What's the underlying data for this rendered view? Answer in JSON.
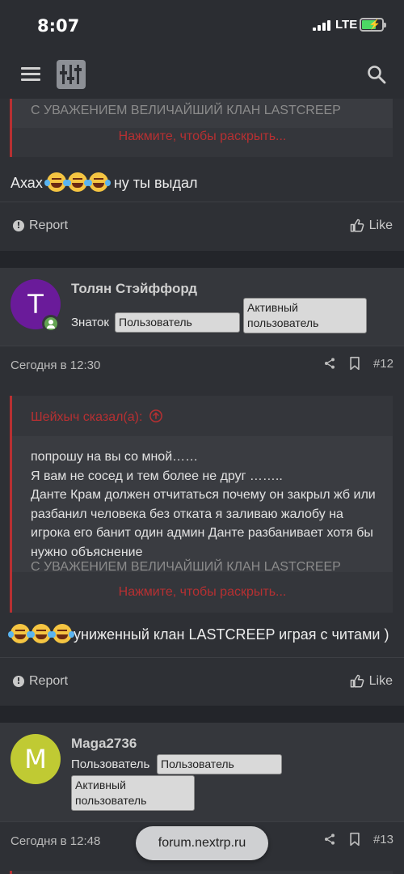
{
  "status_bar": {
    "time": "8:07",
    "network": "LTE"
  },
  "header": {
    "menu_icon": "hamburger-icon",
    "logo_icon": "forum-logo-icon",
    "search_icon": "search-icon"
  },
  "posts": [
    {
      "quote_fade_line": "С УВАЖЕНИЕМ ВЕЛИЧАЙШИЙ КЛАН LASTCREEP",
      "expand_label": "Нажмите, чтобы раскрыть...",
      "message_prefix": "Ахах",
      "message_suffix": "ну ты выдал",
      "report_label": "Report",
      "like_label": "Like"
    },
    {
      "username": "Толян Стэйффорд",
      "avatar_letter": "T",
      "avatar_color": "#6a1b9a",
      "rank": "Знаток",
      "badges": [
        "Пользователь",
        "Активный пользователь"
      ],
      "date": "Сегодня в 12:30",
      "post_number": "#12",
      "quote_author": "Шейхыч сказал(а):",
      "quote_lines": [
        "попрошу на вы со мной……",
        "Я вам не сосед и тем более не друг ……..",
        "Данте Крам должен отчитаться почему он закрыл жб или разбанил человека без отката я заливаю жалобу на игрока его банит один админ Данте разбанивает хотя бы нужно объяснение"
      ],
      "quote_fade_line": "С УВАЖЕНИЕМ ВЕЛИЧАЙШИЙ КЛАН LASTCREEP",
      "expand_label": "Нажмите, чтобы раскрыть...",
      "message_suffix": "униженный клан LASTCREEP играя с читами )",
      "report_label": "Report",
      "like_label": "Like"
    },
    {
      "username": "Maga2736",
      "avatar_letter": "M",
      "avatar_color": "#c0ca33",
      "rank": "Пользователь",
      "badges": [
        "Пользователь",
        "Активный пользователь"
      ],
      "date": "Сегодня в 12:48",
      "post_number": "#13"
    }
  ],
  "url_bar": {
    "domain": "forum.nextrp.ru"
  },
  "colors": {
    "background": "#23252a",
    "post": "#2e3035",
    "accent_red": "#b73032",
    "online": "#63a452"
  }
}
